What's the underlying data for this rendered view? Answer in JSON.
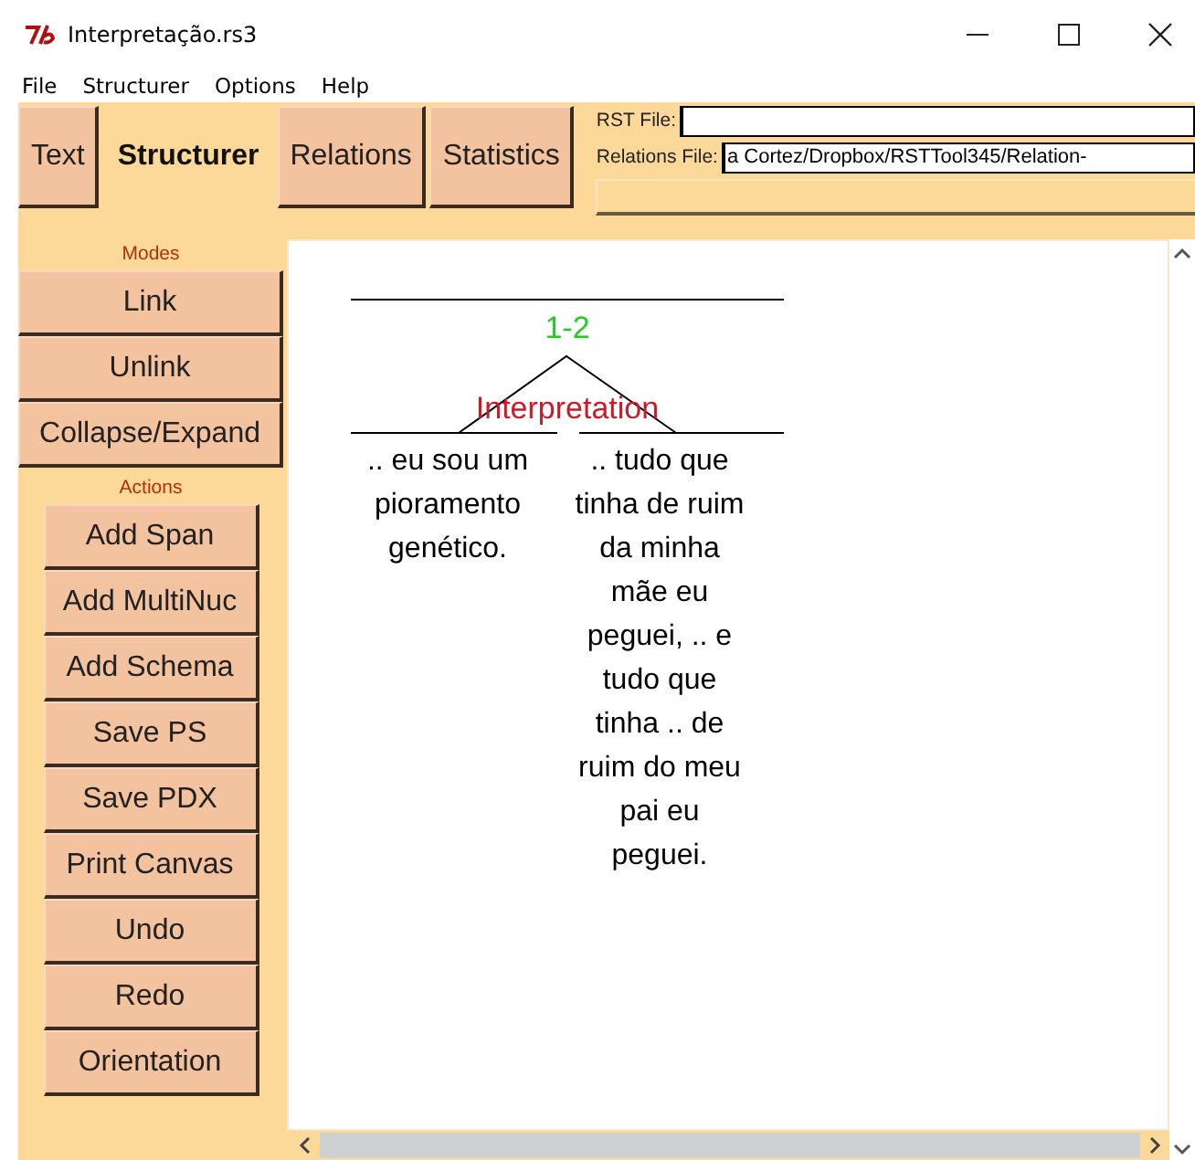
{
  "window": {
    "title": "Interpretação.rs3"
  },
  "menu": [
    "File",
    "Structurer",
    "Options",
    "Help"
  ],
  "tabs": [
    {
      "label": "Text",
      "selected": false
    },
    {
      "label": "Structurer",
      "selected": true
    },
    {
      "label": "Relations",
      "selected": false
    },
    {
      "label": "Statistics",
      "selected": false
    }
  ],
  "files": {
    "rst_file": {
      "label": "RST File:"
    },
    "relations_file": {
      "label": "Relations File:",
      "value": "a Cortez/Dropbox/RSTTool345/Relation-"
    }
  },
  "modes": {
    "heading": "Modes",
    "buttons": [
      "Link",
      "Unlink",
      "Collapse/Expand"
    ]
  },
  "actions": {
    "heading": "Actions",
    "buttons": [
      "Add Span",
      "Add MultiNuc",
      "Add Schema",
      "Save PS",
      "Save PDX",
      "Print Canvas",
      "Undo",
      "Redo",
      "Orientation"
    ]
  },
  "diagram": {
    "span": "1-2",
    "relation": "Interpretation",
    "segments": [
      ".. eu sou um pioramento genético.",
      ".. tudo que tinha de ruim da minha mãe eu peguei, .. e tudo que tinha .. de ruim do meu pai eu peguei."
    ]
  }
}
